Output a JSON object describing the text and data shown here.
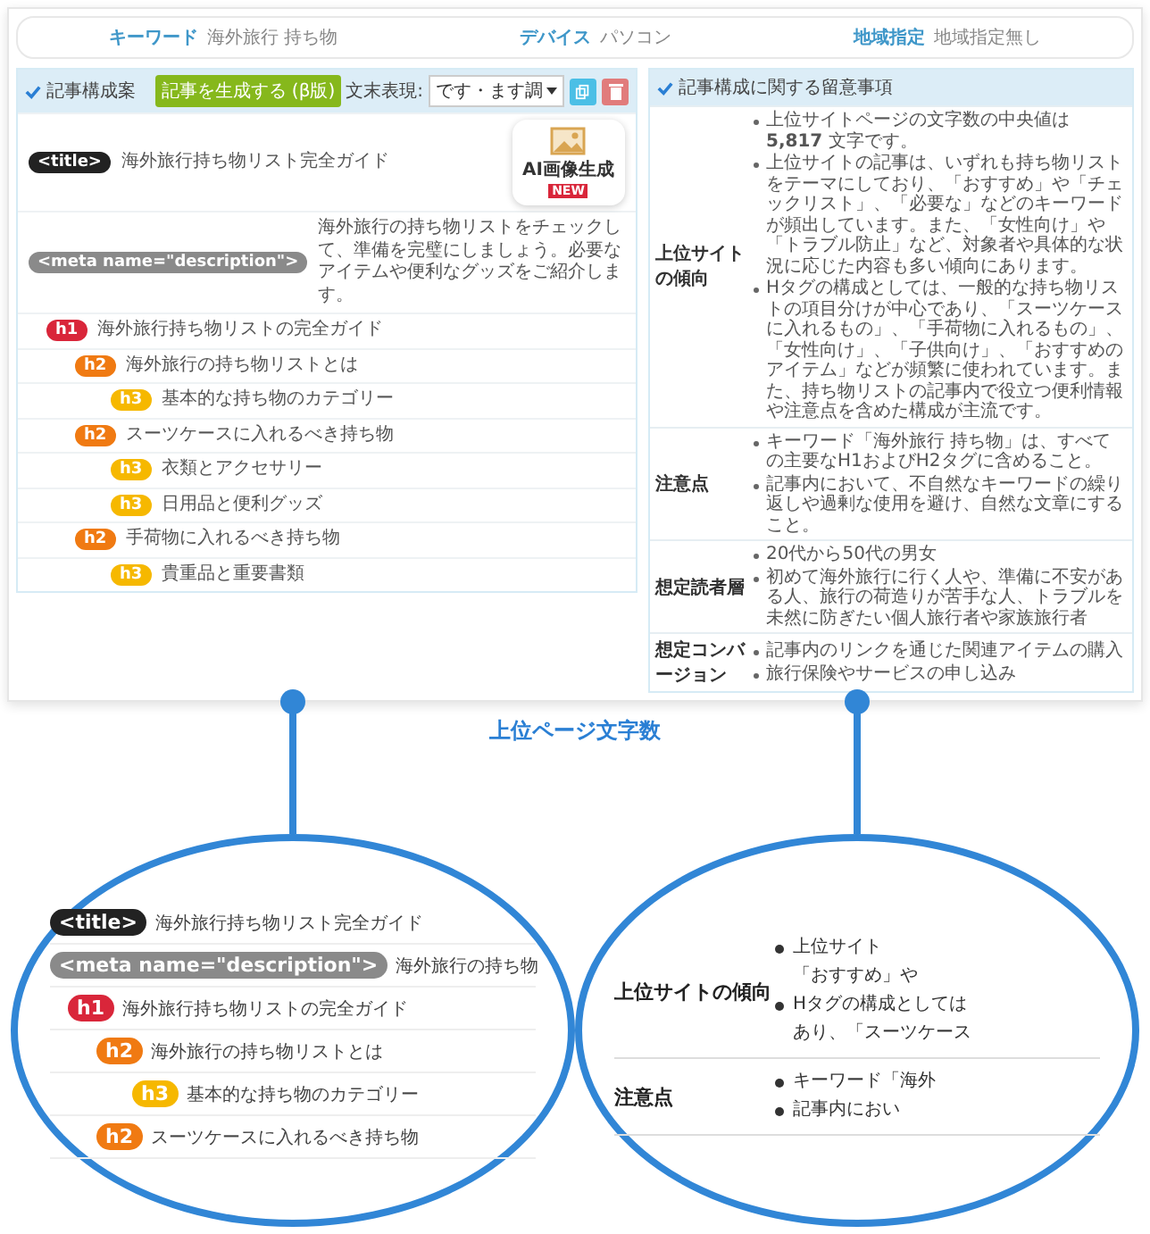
{
  "filters": [
    {
      "label": "キーワード",
      "value": "海外旅行 持ち物"
    },
    {
      "label": "デバイス",
      "value": "パソコン"
    },
    {
      "label": "地域指定",
      "value": "地域指定無し"
    }
  ],
  "outline_panel": {
    "title": "記事構成案",
    "generate_button": "記事を生成する (β版)",
    "style_label": "文末表現:",
    "style_select": "です・ます調",
    "ai_image": {
      "label": "AI画像生成",
      "badge": "NEW"
    },
    "rows": [
      {
        "kind": "title",
        "tag": "<title>",
        "text": "海外旅行持ち物リスト完全ガイド"
      },
      {
        "kind": "meta",
        "tag": "<meta name=\"description\">",
        "text": "海外旅行の持ち物リストをチェックして、準備を完璧にしましょう。必要なアイテムや便利なグッズをご紹介します。"
      },
      {
        "kind": "h1",
        "tag": "h1",
        "text": "海外旅行持ち物リストの完全ガイド"
      },
      {
        "kind": "h2",
        "tag": "h2",
        "text": "海外旅行の持ち物リストとは"
      },
      {
        "kind": "h3",
        "tag": "h3",
        "text": "基本的な持ち物のカテゴリー"
      },
      {
        "kind": "h2",
        "tag": "h2",
        "text": "スーツケースに入れるべき持ち物"
      },
      {
        "kind": "h3",
        "tag": "h3",
        "text": "衣類とアクセサリー"
      },
      {
        "kind": "h3",
        "tag": "h3",
        "text": "日用品と便利グッズ"
      },
      {
        "kind": "h2",
        "tag": "h2",
        "text": "手荷物に入れるべき持ち物"
      },
      {
        "kind": "h3",
        "tag": "h3",
        "text": "貴重品と重要書類"
      }
    ]
  },
  "notes_panel": {
    "title": "記事構成に関する留意事項",
    "sections": [
      {
        "label": "上位サイトの傾向",
        "bullets": [
          "上位サイトページの文字数の中央値は **5,817** 文字です。",
          "上位サイトの記事は、いずれも持ち物リストをテーマにしており、「おすすめ」や「チェックリスト」、「必要な」などのキーワードが頻出しています。また、「女性向け」や「トラブル防止」など、対象者や具体的な状況に応じた内容も多い傾向にあります。",
          "Hタグの構成としては、一般的な持ち物リストの項目分けが中心であり、「スーツケースに入れるもの」、「手荷物に入れるもの」、「女性向け」、「子供向け」、「おすすめのアイテム」などが頻繁に使われています。また、持ち物リストの記事内で役立つ便利情報や注意点を含めた構成が主流です。"
        ]
      },
      {
        "label": "注意点",
        "bullets": [
          "キーワード「海外旅行 持ち物」は、すべての主要なH1およびH2タグに含めること。",
          "記事内において、不自然なキーワードの繰り返しや過剰な使用を避け、自然な文章にすること。"
        ]
      },
      {
        "label": "想定読者層",
        "bullets": [
          "20代から50代の男女",
          "初めて海外旅行に行く人や、準備に不安がある人、旅行の荷造りが苦手な人、トラブルを未然に防ぎたい個人旅行者や家族旅行者"
        ]
      },
      {
        "label": "想定コンバージョン",
        "bullets": [
          "記事内のリンクを通じた関連アイテムの購入",
          "旅行保険やサービスの申し込み"
        ]
      }
    ]
  },
  "callout_label": "上位ページ文字数",
  "lenses": [
    {
      "kind": "outline",
      "rows": [
        {
          "kind": "title",
          "tag": "<title>",
          "text": "海外旅行持ち物リスト完全ガイド"
        },
        {
          "kind": "meta",
          "tag": "<meta name=\"description\">",
          "text": "海外旅行の持ち物"
        },
        {
          "kind": "h1",
          "tag": "h1",
          "text": "海外旅行持ち物リストの完全ガイド"
        },
        {
          "kind": "h2",
          "tag": "h2",
          "text": "海外旅行の持ち物リストとは"
        },
        {
          "kind": "h3",
          "tag": "h3",
          "text": "基本的な持ち物のカテゴリー"
        },
        {
          "kind": "h2",
          "tag": "h2",
          "text": "スーツケースに入れるべき持ち物"
        }
      ]
    },
    {
      "kind": "notes",
      "sections": [
        {
          "label": "上位サイトの傾向",
          "lines": [
            {
              "text": "上位サイト",
              "bullet": true
            },
            {
              "text": "「おすすめ」や",
              "bullet": false
            },
            {
              "text": "Hタグの構成としては",
              "bullet": true
            },
            {
              "text": "あり、「スーツケース",
              "bullet": false
            }
          ]
        },
        {
          "label": "注意点",
          "lines": [
            {
              "text": "キーワード「海外",
              "bullet": true
            },
            {
              "text": "記事内におい",
              "bullet": true
            }
          ]
        }
      ]
    }
  ]
}
